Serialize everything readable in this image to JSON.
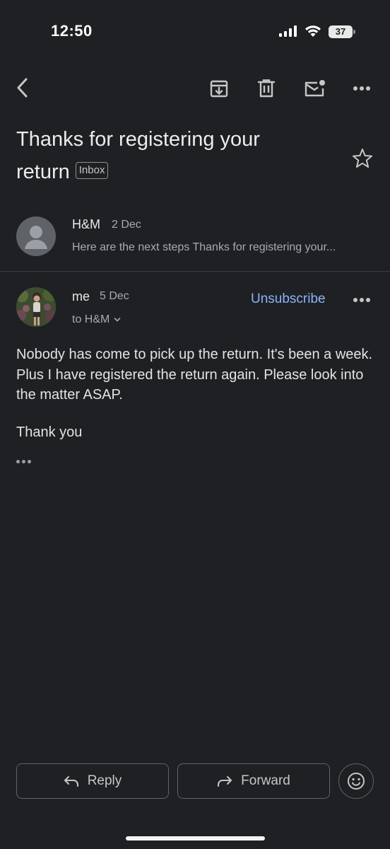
{
  "status_bar": {
    "time": "12:50",
    "battery": "37"
  },
  "toolbar": {
    "back_icon": "chevron-left-icon",
    "archive_icon": "archive-icon",
    "delete_icon": "trash-icon",
    "unread_icon": "mark-unread-icon",
    "more_icon": "more-horizontal-icon"
  },
  "subject": {
    "title": "Thanks for registering your return",
    "label": "Inbox"
  },
  "messages": [
    {
      "sender": "H&M",
      "date": "2 Dec",
      "snippet": "Here are the next steps Thanks for registering your..."
    },
    {
      "sender": "me",
      "date": "5 Dec",
      "recipient": "to H&M",
      "unsubscribe_label": "Unsubscribe",
      "body": "Nobody has come to pick up the return. It's been a week. Plus I have registered the return again. Please look into the matter ASAP.",
      "signoff": "Thank you"
    }
  ],
  "actions": {
    "reply_label": "Reply",
    "forward_label": "Forward",
    "emoji_icon": "emoji-reaction-icon"
  },
  "colors": {
    "background": "#1f2023",
    "link": "#8ab4f8",
    "text": "#e3e3e3",
    "muted": "#a8abae"
  }
}
